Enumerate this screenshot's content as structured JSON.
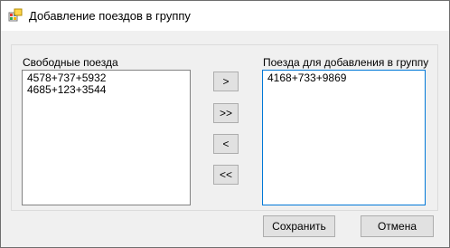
{
  "window": {
    "title": "Добавление поездов в группу"
  },
  "available": {
    "label": "Свободные поезда",
    "items": [
      "4578+737+5932",
      "4685+123+3544"
    ]
  },
  "selected": {
    "label": "Поезда для добавления в группу",
    "items": [
      "4168+733+9869"
    ]
  },
  "transfer": {
    "move_right": ">",
    "move_all_right": ">>",
    "move_left": "<",
    "move_all_left": "<<"
  },
  "footer": {
    "save_label": "Сохранить",
    "cancel_label": "Отмена"
  },
  "colors": {
    "focus_border": "#0078d7",
    "button_face": "#e1e1e1"
  }
}
